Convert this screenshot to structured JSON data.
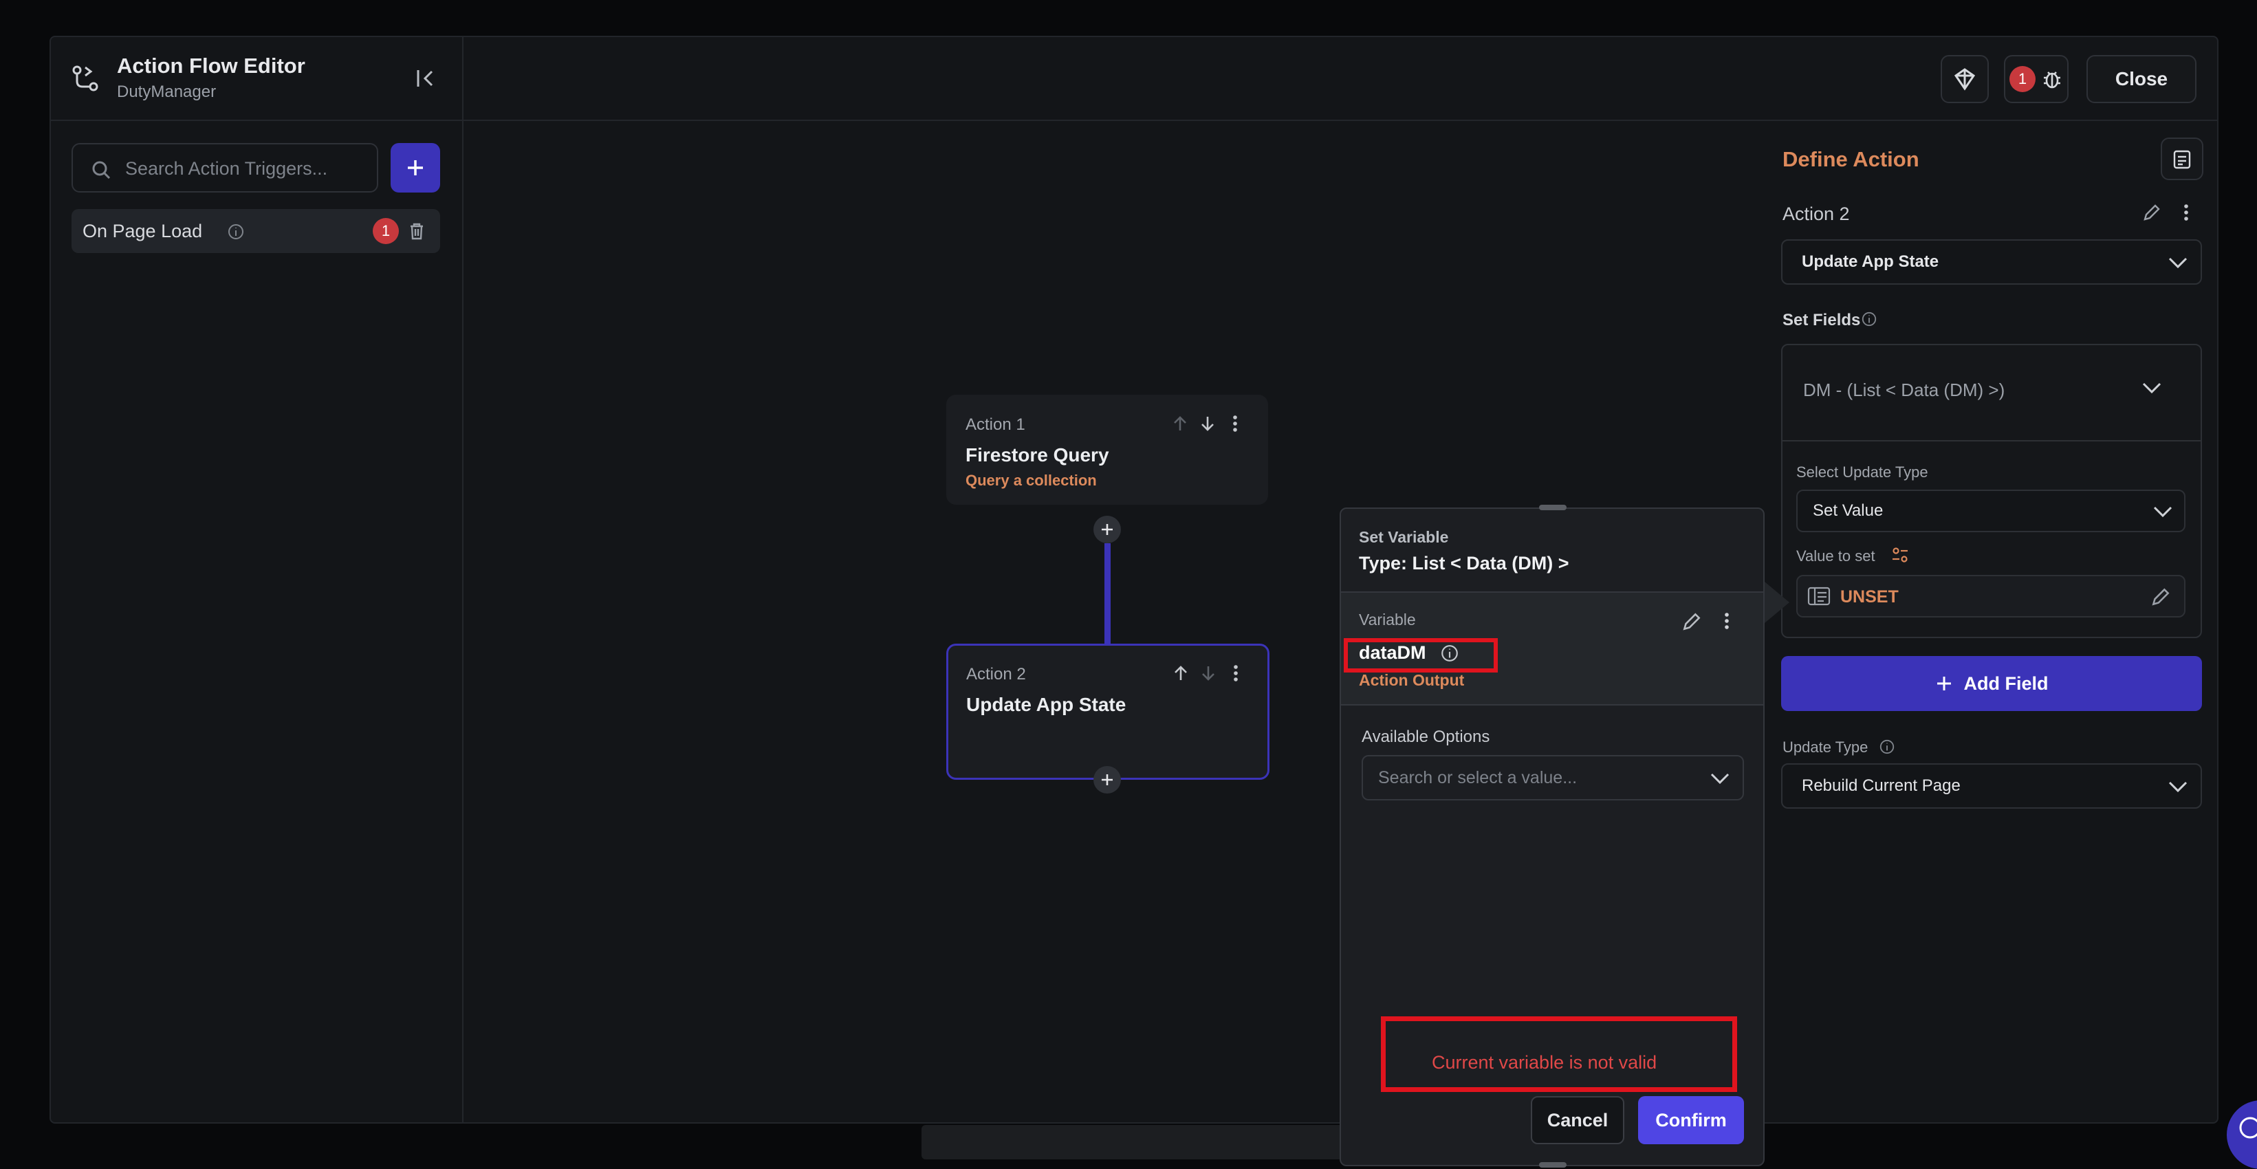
{
  "header": {
    "title": "Action Flow Editor",
    "subtitle": "DutyManager",
    "issue_count": "1",
    "close_label": "Close"
  },
  "sidebar": {
    "search_placeholder": "Search Action Triggers...",
    "triggers": [
      {
        "label": "On Page Load",
        "badge": "1"
      }
    ]
  },
  "canvas": {
    "actions": [
      {
        "index_label": "Action 1",
        "title": "Firestore Query",
        "subtitle": "Query a collection"
      },
      {
        "index_label": "Action 2",
        "title": "Update App State",
        "subtitle": ""
      }
    ]
  },
  "set_variable": {
    "heading": "Set Variable",
    "type": "Type: List < Data (DM) >",
    "variable_label": "Variable",
    "variable_name": "dataDM",
    "variable_source": "Action Output",
    "options_label": "Available Options",
    "options_placeholder": "Search or select a value...",
    "error": "Current variable is not valid",
    "cancel_label": "Cancel",
    "confirm_label": "Confirm"
  },
  "define_action": {
    "title": "Define Action",
    "action_label": "Action 2",
    "action_type": "Update App State",
    "set_fields_label": "Set Fields",
    "field_value": "DM - (List < Data (DM) >)",
    "update_type_select_label": "Select Update Type",
    "update_type_value": "Set Value",
    "value_to_set_label": "Value to set",
    "value_to_set": "UNSET",
    "add_field_label": "Add Field",
    "rebuild_label": "Update Type",
    "rebuild_value": "Rebuild Current Page"
  },
  "colors": {
    "accent": "#3b33b8",
    "confirm": "#4f45e4",
    "orange": "#dd8a5c",
    "error": "#e04848"
  }
}
